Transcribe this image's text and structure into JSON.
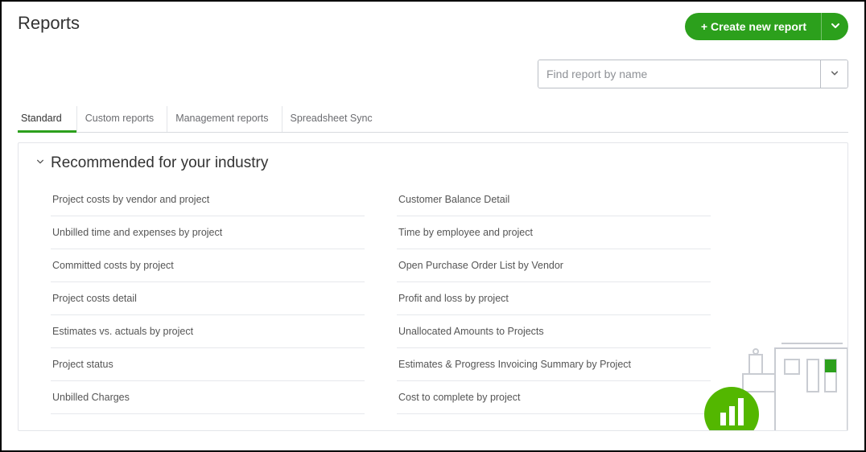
{
  "header": {
    "title": "Reports",
    "create_button": "+ Create new report"
  },
  "search": {
    "placeholder": "Find report by name",
    "value": ""
  },
  "tabs": [
    {
      "label": "Standard",
      "active": true
    },
    {
      "label": "Custom reports",
      "active": false
    },
    {
      "label": "Management reports",
      "active": false
    },
    {
      "label": "Spreadsheet Sync",
      "active": false
    }
  ],
  "section": {
    "title": "Recommended for your industry",
    "left": [
      "Project costs by vendor and project",
      "Unbilled time and expenses by project",
      "Committed costs by project",
      "Project costs detail",
      "Estimates vs. actuals by project",
      "Project status",
      "Unbilled Charges"
    ],
    "right": [
      "Customer Balance Detail",
      "Time by employee and project",
      "Open Purchase Order List by Vendor",
      "Profit and loss by project",
      "Unallocated Amounts to Projects",
      "Estimates & Progress Invoicing Summary by Project",
      "Cost to complete by project"
    ]
  }
}
